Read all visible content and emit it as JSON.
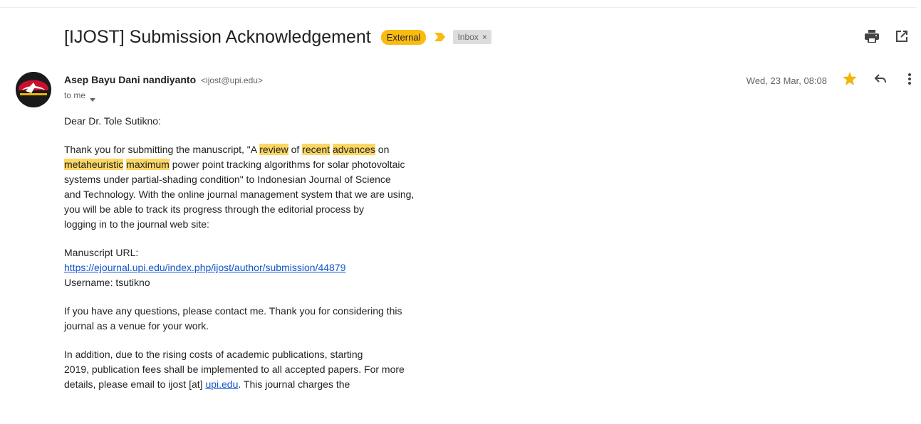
{
  "subject": "[IJOST] Submission Acknowledgement",
  "labels": {
    "external": "External",
    "inbox": "Inbox",
    "inbox_remove": "×"
  },
  "sender": {
    "name": "Asep Bayu Dani nandiyanto",
    "email": "<ijost@upi.edu>"
  },
  "recipient": "to me",
  "date": "Wed, 23 Mar, 08:08",
  "icons": {
    "print": "print-icon",
    "open_new_window": "open-in-new-window-icon",
    "star": "star-icon",
    "reply": "reply-icon",
    "more": "more-vert-icon",
    "importance": "importance-marker-icon",
    "caret": "chevron-down-icon"
  },
  "colors": {
    "external_label": "#f9bb10",
    "highlight": "#fdd663",
    "star": "#f4b400",
    "link": "#1155cc"
  },
  "body": {
    "greeting": "Dear Dr. Tole Sutikno:",
    "p1": {
      "t0": "Thank you for submitting the manuscript, \"A ",
      "h1": "review",
      "t1": " of ",
      "h2": "recent",
      "t2": " ",
      "h3": "advances",
      "t3": " on",
      "h4": "metaheuristic",
      "t4": " ",
      "h5": "maximum",
      "t5": " power point tracking algorithms for solar photovoltaic",
      "l3": "systems under partial-shading condition\" to Indonesian Journal of Science",
      "l4": "and Technology. With the online journal management system that we are using,",
      "l5": "you will be able to track its progress through the editorial process by",
      "l6": "logging in to the journal web site:"
    },
    "manuscript_label": "Manuscript URL:",
    "manuscript_url": "https://ejournal.upi.edu/index.php/ijost/author/submission/44879",
    "username": "Username: tsutikno",
    "p3": {
      "l1": "If you have any questions, please contact me. Thank you for considering this",
      "l2": "journal as a venue for your work."
    },
    "p4": {
      "l1": "In addition, due to the rising costs of academic publications, starting",
      "l2": "2019, publication fees shall be implemented to all accepted papers. For more",
      "l3a": "details, please email to ijost [at] ",
      "l3link": "upi.edu",
      "l3b": ". This journal charges the"
    }
  }
}
